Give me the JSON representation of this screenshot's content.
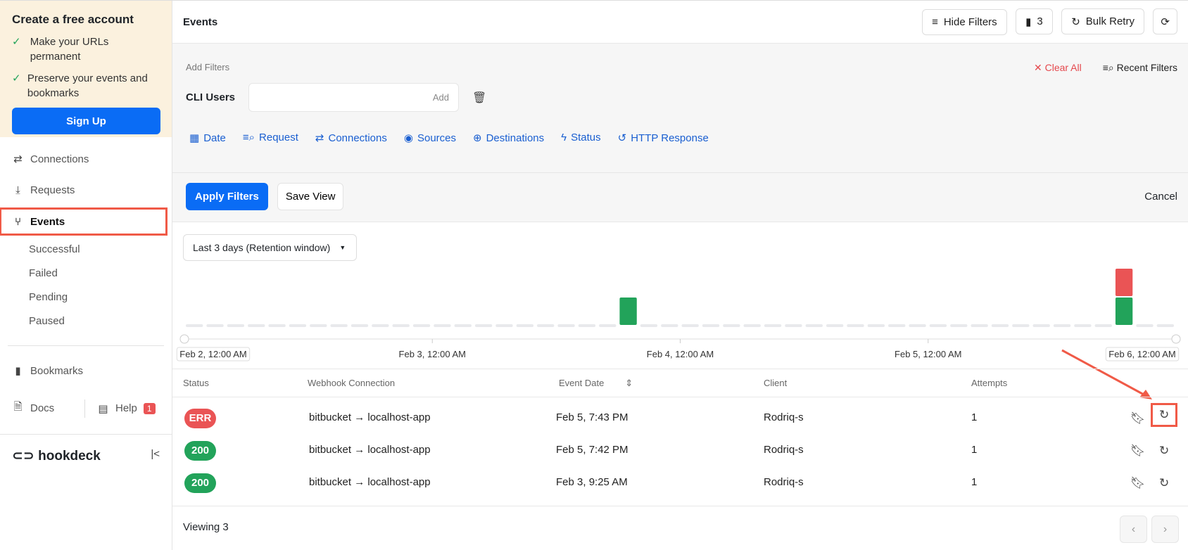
{
  "promo": {
    "title": "Create a free account",
    "points": [
      "Make your URLs permanent",
      "Preserve your events and bookmarks"
    ],
    "signup": "Sign Up"
  },
  "nav": {
    "connections": "Connections",
    "requests": "Requests",
    "events": "Events",
    "sub": [
      "Successful",
      "Failed",
      "Pending",
      "Paused"
    ],
    "bookmarks": "Bookmarks",
    "docs": "Docs",
    "help": "Help",
    "help_badge": "1"
  },
  "brand": "hookdeck",
  "header": {
    "title": "Events",
    "hide_filters": "Hide Filters",
    "count": "3",
    "bulk_retry": "Bulk Retry"
  },
  "filters": {
    "add_label": "Add Filters",
    "clear_all": "Clear All",
    "recent": "Recent Filters",
    "cli_label": "CLI Users",
    "cli_value": "",
    "add": "Add",
    "types": [
      "Date",
      "Request",
      "Connections",
      "Sources",
      "Destinations",
      "Status",
      "HTTP Response"
    ],
    "apply": "Apply Filters",
    "save_view": "Save View",
    "cancel": "Cancel"
  },
  "range": "Last 3 days (Retention window)",
  "chart_data": {
    "type": "bar",
    "stacked": true,
    "x_ticks": [
      "Feb 2, 12:00 AM",
      "Feb 3, 12:00 AM",
      "Feb 4, 12:00 AM",
      "Feb 5, 12:00 AM",
      "Feb 6, 12:00 AM"
    ],
    "bins": 48,
    "series": [
      {
        "name": "successful",
        "color": "#22a35a",
        "points": [
          {
            "bin": 21,
            "value": 1
          },
          {
            "bin": 45,
            "value": 1
          }
        ]
      },
      {
        "name": "failed",
        "color": "#ea5455",
        "points": [
          {
            "bin": 45,
            "value": 1
          }
        ]
      }
    ]
  },
  "table": {
    "headers": [
      "Status",
      "Webhook Connection",
      "Event Date",
      "Client",
      "Attempts"
    ],
    "rows": [
      {
        "status": "ERR",
        "color": "#ea5455",
        "connection": "bitbucket → localhost-app",
        "date": "Feb 5, 7:43 PM",
        "client": "Rodriq-s",
        "attempts": "1"
      },
      {
        "status": "200",
        "color": "#22a35a",
        "connection": "bitbucket → localhost-app",
        "date": "Feb 5, 7:42 PM",
        "client": "Rodriq-s",
        "attempts": "1"
      },
      {
        "status": "200",
        "color": "#22a35a",
        "connection": "bitbucket → localhost-app",
        "date": "Feb 3, 9:25 AM",
        "client": "Rodriq-s",
        "attempts": "1"
      }
    ]
  },
  "footer": {
    "viewing": "Viewing 3"
  }
}
